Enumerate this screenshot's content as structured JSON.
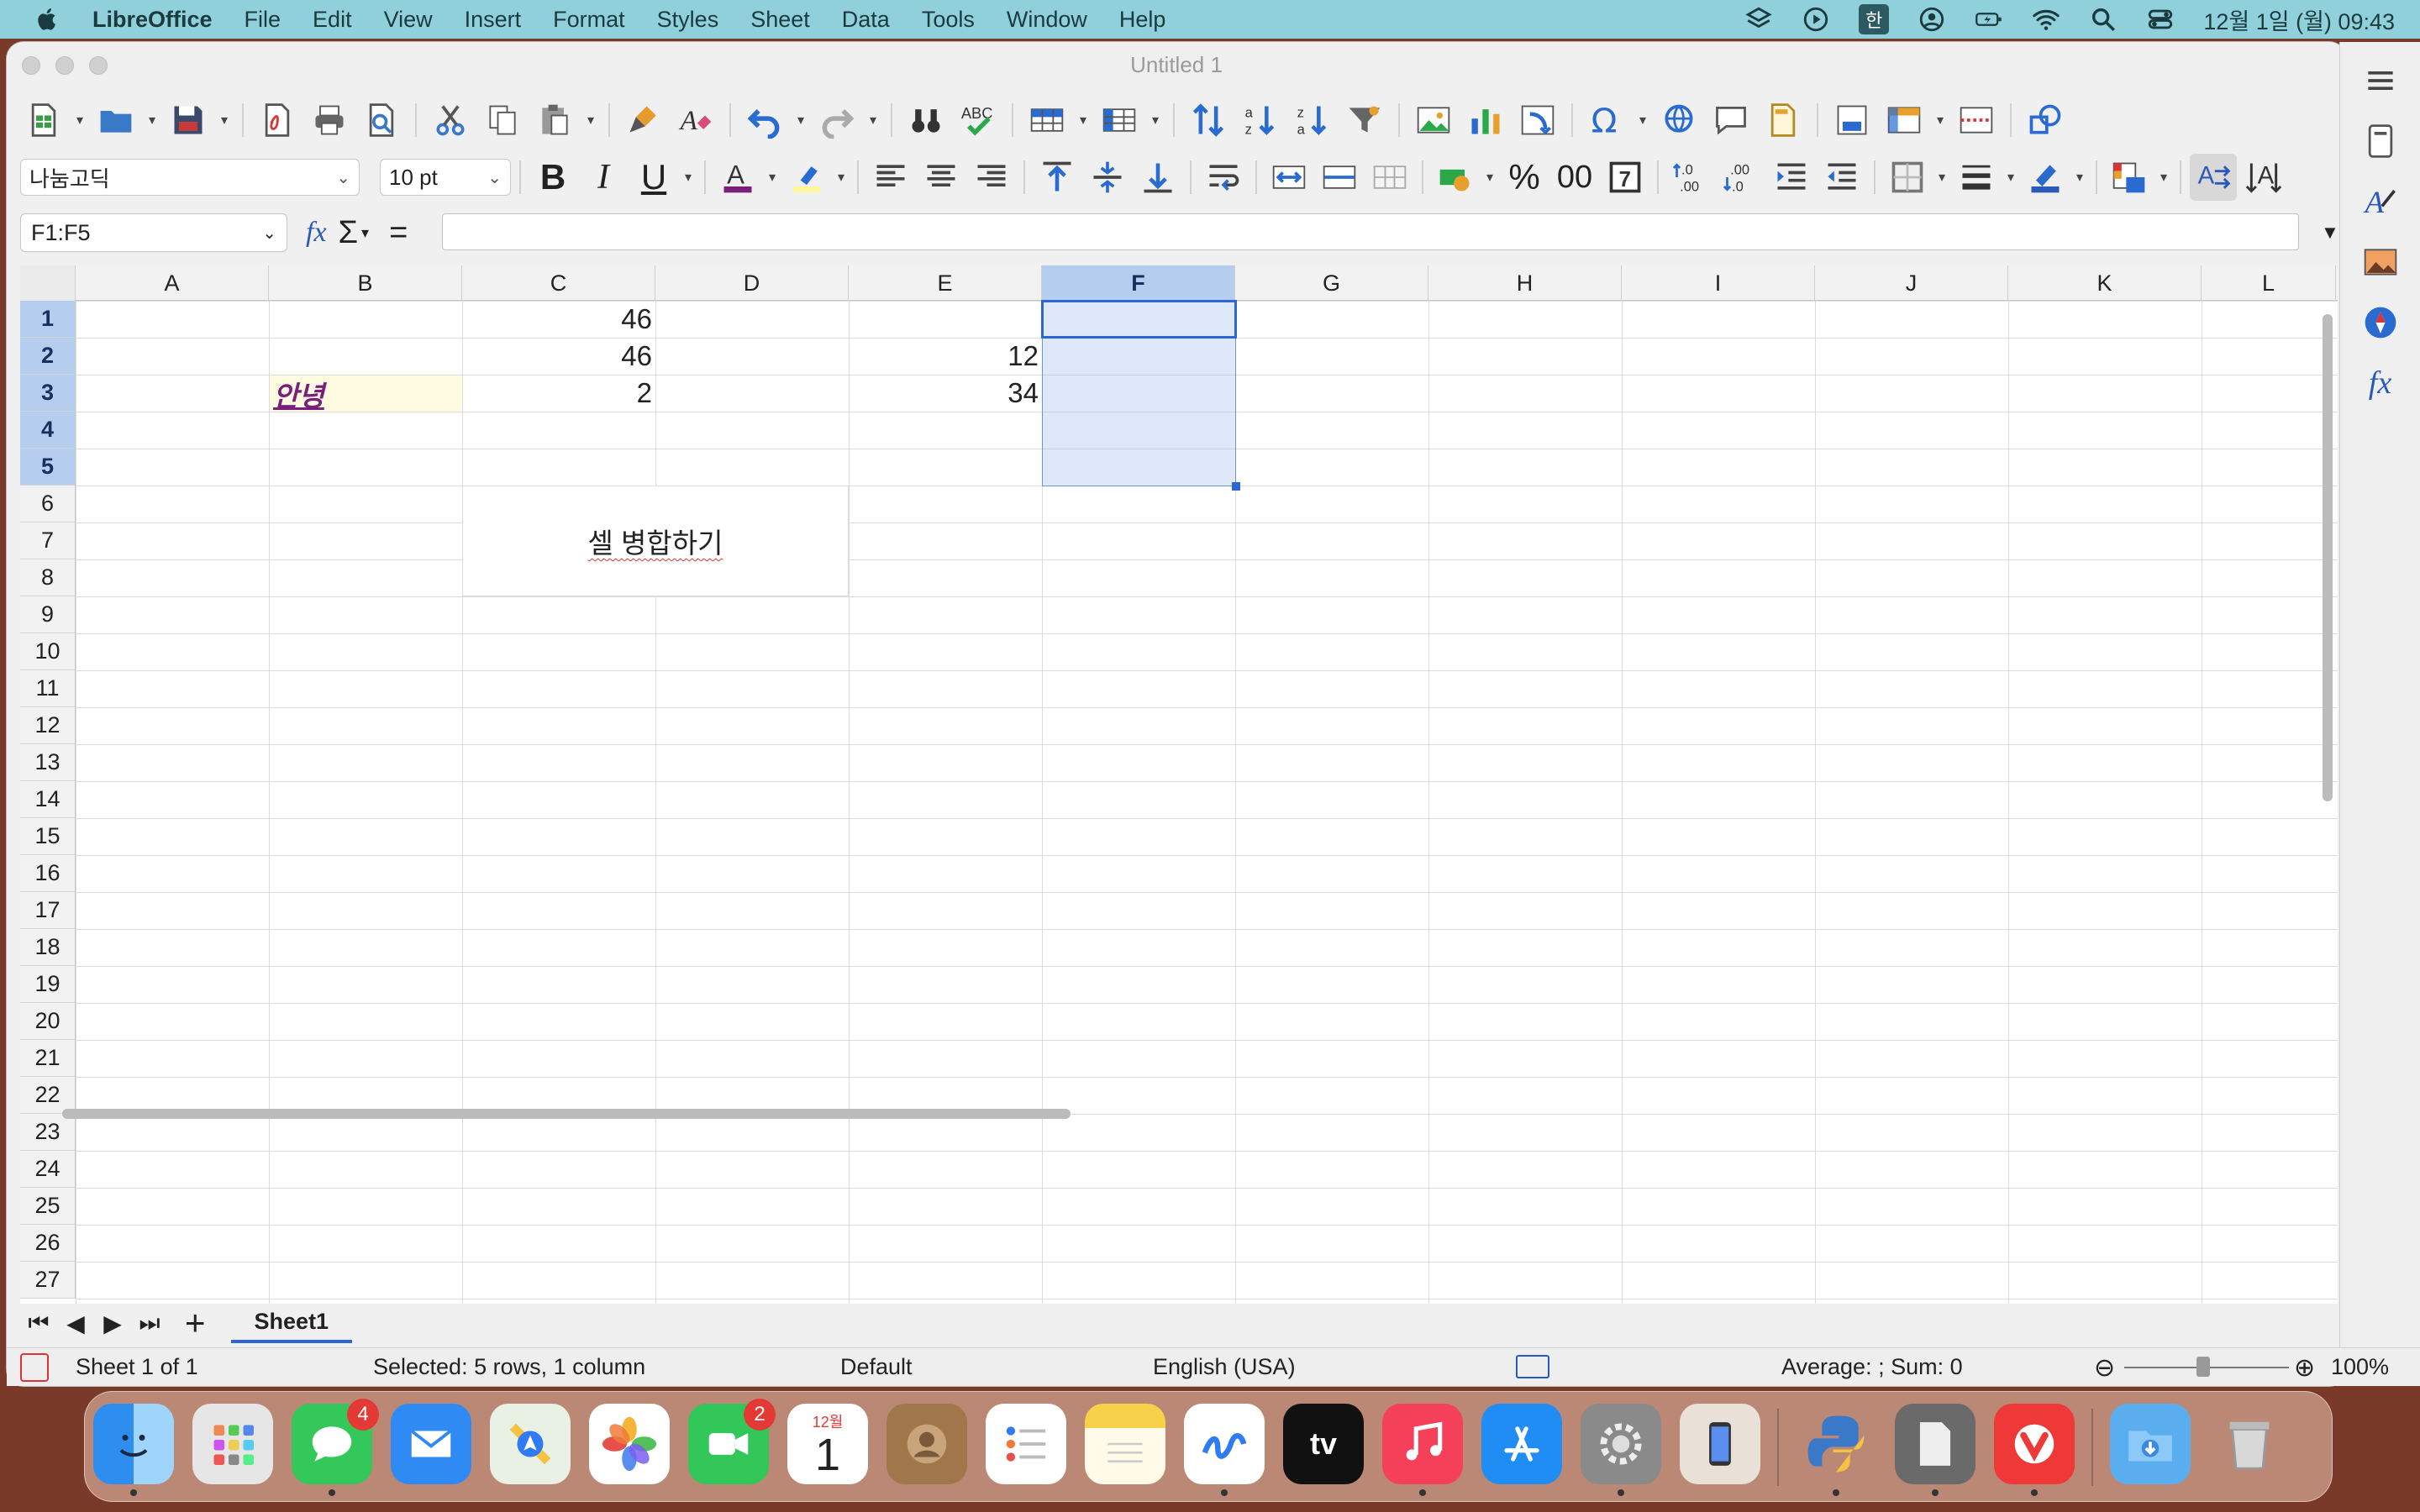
{
  "menubar": {
    "app": "LibreOffice",
    "items": [
      "File",
      "Edit",
      "View",
      "Insert",
      "Format",
      "Styles",
      "Sheet",
      "Data",
      "Tools",
      "Window",
      "Help"
    ],
    "input_method": "한",
    "clock": "12월 1일 (월) 09:43"
  },
  "window": {
    "title": "Untitled 1"
  },
  "toolbar2": {
    "font_name": "나눔고딕",
    "font_size": "10 pt"
  },
  "formula": {
    "name_box": "F1:F5",
    "content": ""
  },
  "columns": [
    "A",
    "B",
    "C",
    "D",
    "E",
    "F",
    "G",
    "H",
    "I",
    "J",
    "K",
    "L"
  ],
  "rows": [
    "1",
    "2",
    "3",
    "4",
    "5",
    "6",
    "7",
    "8",
    "9",
    "10",
    "11",
    "12",
    "13",
    "14",
    "15",
    "16",
    "17",
    "18",
    "19",
    "20",
    "21",
    "22",
    "23",
    "24",
    "25",
    "26",
    "27"
  ],
  "cells": {
    "c1": "46",
    "c2": "46",
    "c3": "2",
    "e2": "12",
    "e3": "34",
    "b3": "안녕",
    "merged_c6_d8": "셀 병합하기"
  },
  "selection": {
    "range": "F1:F5",
    "active_column": "F"
  },
  "sheet_tabs": [
    "Sheet1"
  ],
  "statusbar": {
    "sheet": "Sheet 1 of 1",
    "selected": "Selected: 5 rows, 1 column",
    "style": "Default",
    "language": "English (USA)",
    "summary": "Average: ; Sum: 0",
    "zoom": "100%"
  },
  "dock": {
    "messages_badge": "4",
    "facetime_badge": "2",
    "calendar_month": "12월",
    "calendar_day": "1"
  },
  "colors": {
    "accent": "#2b67d2",
    "selection": "#b5cdee",
    "b3_text": "#7a1f7a",
    "b3_bg": "#fffbe0"
  }
}
